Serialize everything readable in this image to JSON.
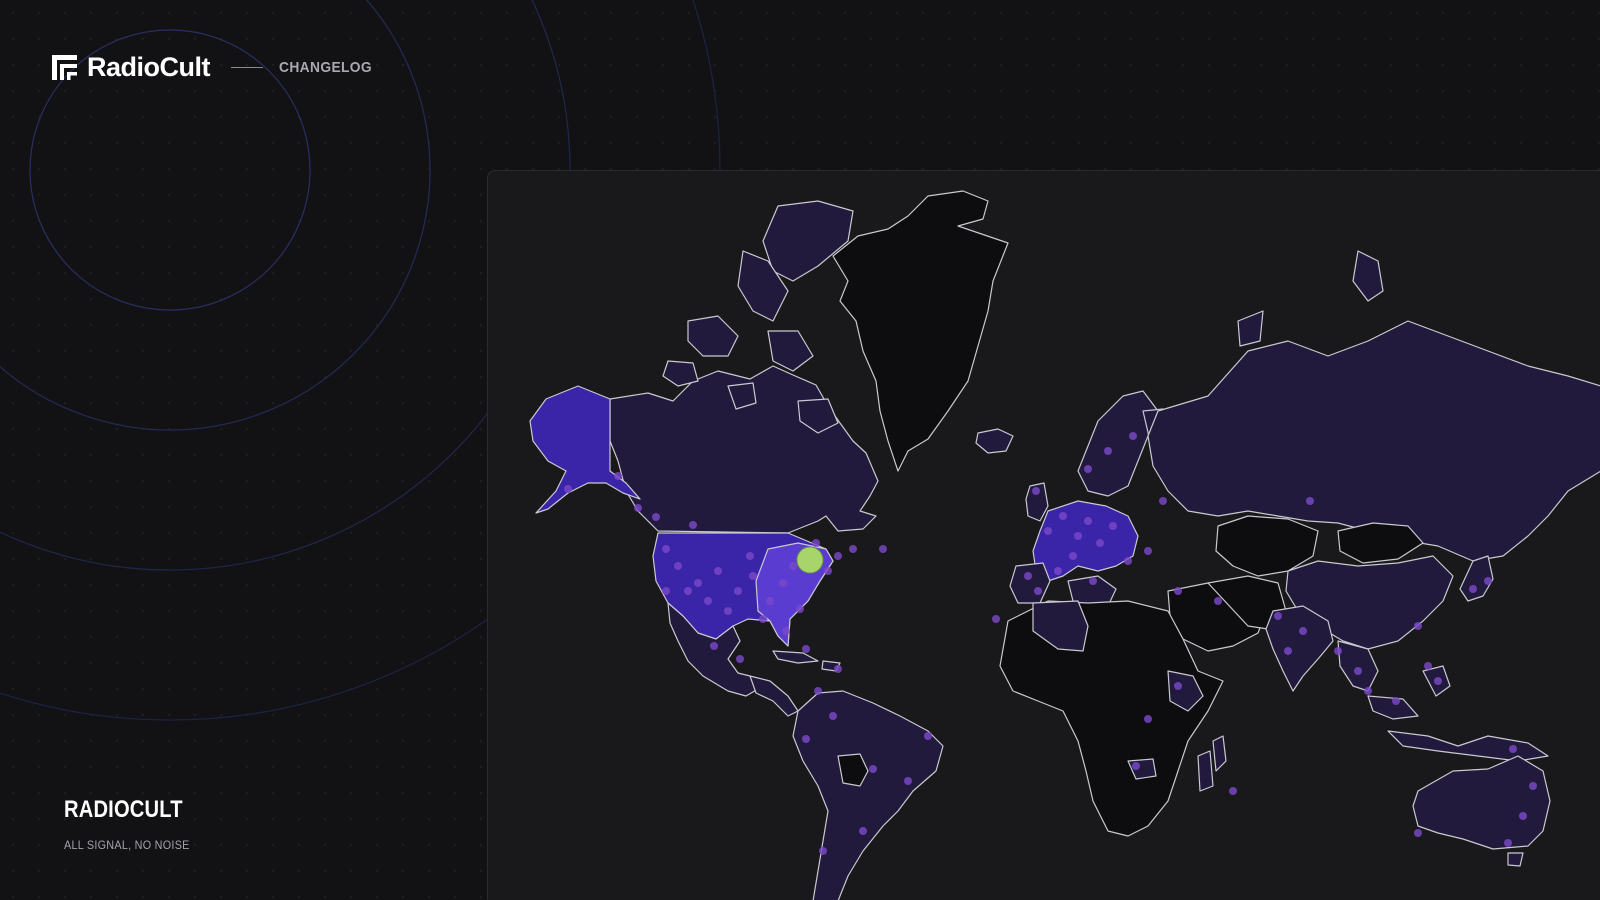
{
  "header": {
    "logo_text": "RadioCult",
    "changelog_label": "CHANGELOG"
  },
  "footer": {
    "brand_name": "RADIOCULT",
    "tagline": "ALL SIGNAL, NO NOISE"
  },
  "map": {
    "theme": {
      "ocean": "#19191c",
      "no_listeners": "#0d0d10",
      "low_listeners": "#211a3c",
      "medium_listeners": "#3a24a8",
      "high_listeners": "#5a3dd0",
      "highlight": "#a8d46c",
      "border": "#c9c9cf",
      "listener_dot": "#7a48c8"
    },
    "highlighted_location": "Eastern United States"
  },
  "decor": {
    "ring_color": "#272a52"
  }
}
